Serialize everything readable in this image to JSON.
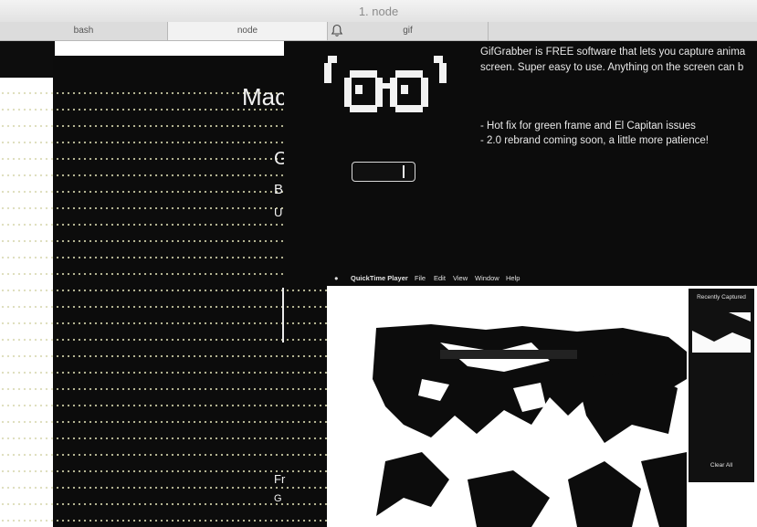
{
  "window": {
    "title": "1. node"
  },
  "tabs": [
    {
      "label": "bash",
      "active": false
    },
    {
      "label": "node",
      "active": true
    },
    {
      "label": "gif",
      "active": false
    }
  ],
  "page": {
    "heading": "Mac",
    "fragments": [
      "G",
      "B",
      "U",
      "Fr",
      "G"
    ]
  },
  "right_panel": {
    "line1": "GifGrabber is FREE software that lets you capture anima",
    "line2": "screen. Super easy to use. Anything on the screen can b",
    "bullet1": "- Hot fix for green frame and El Capitan issues",
    "bullet2": "- 2.0 rebrand coming soon, a little more patience!"
  },
  "quicktime": {
    "menu": [
      "QuickTime Player",
      "File",
      "Edit",
      "View",
      "Window",
      "Help"
    ],
    "sidebar_title": "Recently Captured",
    "sidebar_footer": "Clear All"
  },
  "colors": {
    "background": "#ffffff",
    "dark": "#0c0c0c",
    "dots": "#d8d8b0"
  },
  "icons": {
    "tab_icon": "bell-icon",
    "logo": "glasses-logo-icon"
  }
}
